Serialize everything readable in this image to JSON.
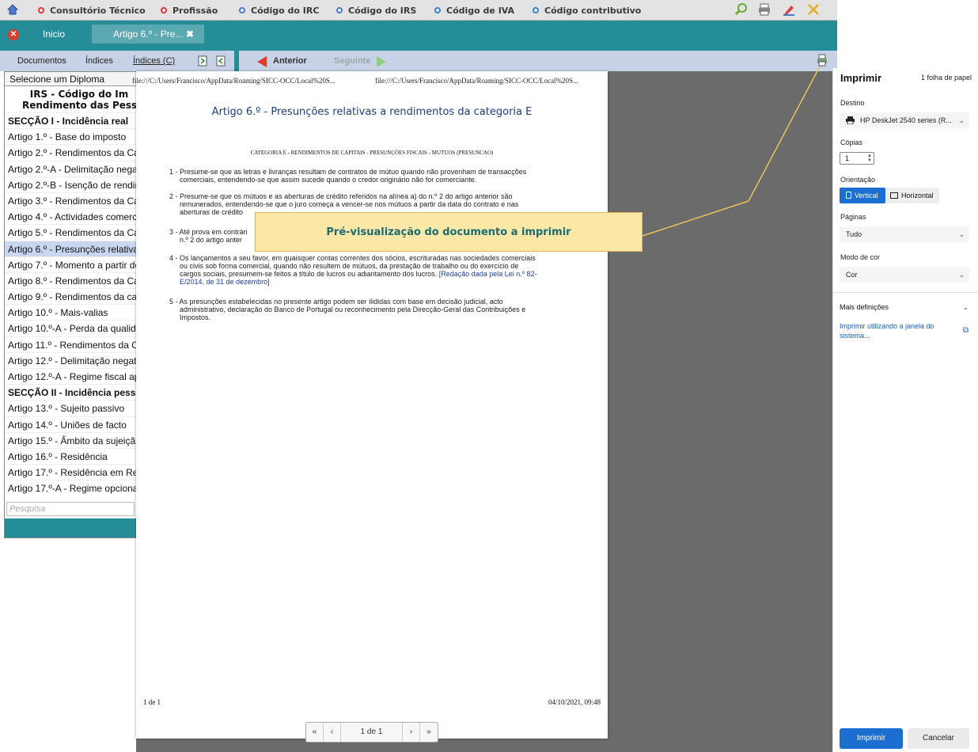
{
  "topbar": {
    "nav": [
      "Consultório Técnico",
      "Profissão",
      "Código do IRC",
      "Código do IRS",
      "Código de IVA",
      "Código contributivo"
    ],
    "nav_colors": [
      "red",
      "red",
      "blue",
      "blue",
      "blue",
      "blue"
    ]
  },
  "tabs": {
    "home": "Inicio",
    "current": "Artigo 6.º - Pre...",
    "close": "✖"
  },
  "subbar": {
    "documentos": "Documentos",
    "indices": "Índices",
    "indices_c": "Índices (C)",
    "anterior": "Anterior",
    "seguinte": "Seguinte"
  },
  "sidebar": {
    "select": "Selecione um Diploma",
    "diploma_line1": "IRS - Código do Im",
    "diploma_line2": "Rendimento das Pess",
    "items": [
      {
        "label": "SECÇÃO I - Incidência real",
        "type": "sec"
      },
      {
        "label": "Artigo 1.º - Base do imposto"
      },
      {
        "label": "Artigo 2.º - Rendimentos da Ca"
      },
      {
        "label": "Artigo 2.º-A - Delimitação negat"
      },
      {
        "label": "Artigo 2.º-B - Isenção de rendin"
      },
      {
        "label": "Artigo 3.º - Rendimentos da Ca"
      },
      {
        "label": "Artigo 4.º - Actividades comerci"
      },
      {
        "label": "Artigo 5.º - Rendimentos da Ca"
      },
      {
        "label": "Artigo 6.º - Presunções relativa",
        "type": "hl"
      },
      {
        "label": "Artigo 7.º - Momento a partir do"
      },
      {
        "label": "Artigo 8.º - Rendimentos da Ca"
      },
      {
        "label": "Artigo 9.º - Rendimentos da cat"
      },
      {
        "label": "Artigo 10.º - Mais-valias"
      },
      {
        "label": "Artigo 10.º-A - Perda da qualida"
      },
      {
        "label": "Artigo 11.º - Rendimentos da C"
      },
      {
        "label": "Artigo 12.º - Delimitação negati"
      },
      {
        "label": "Artigo 12.º-A - Regime fiscal ap"
      },
      {
        "label": "SECÇÃO II - Incidência pessoa",
        "type": "sec"
      },
      {
        "label": "Artigo 13.º - Sujeito passivo"
      },
      {
        "label": "Artigo 14.º - Uniões de facto"
      },
      {
        "label": "Artigo 15.º - Âmbito da sujeiçã"
      },
      {
        "label": "Artigo 16.º - Residência"
      },
      {
        "label": "Artigo 17.º - Residência em Re"
      },
      {
        "label": "Artigo 17.º-A - Regime opciona"
      }
    ],
    "search_placeholder": "Pesquisa"
  },
  "document": {
    "header_left": "file:///C:/Users/Francisco/AppData/Roaming/SICC-OCC/Local%20S...",
    "header_right": "file:///C:/Users/Francisco/AppData/Roaming/SICC-OCC/Local%20S...",
    "title": "Artigo 6.º - Presunções relativas a rendimentos da categoria E",
    "category": "CATEGORIA E - RENDIMENTOS DE CAPITAIS - PRESUNÇÕES FISCAIS - MUTUOS (PRESUNCAO)",
    "p1_a": "1 - Presume-se que as letras e livranças resultam de contratos de mútuo quando não provenham de transacções",
    "p1_b": "comerciais, entendendo-se que assim sucede quando o credor originário não for comerciante.",
    "p2_a": "2 - Presume-se que os mútuos e as aberturas de crédito referidos na alínea a) do n.º 2 do artigo anterior são",
    "p2_b": "remunerados, entendendo-se que o juro começa a vencer-se nos mútuos a partir da data do contrato e nas",
    "p2_c": "aberturas de crédito",
    "p3_a": "3 - Até prova em contrári",
    "p3_b": "n.º 2 do artigo anter",
    "p4_a": "4 - Os lançamentos a seu favor, em quaisquer contas correntes dos sócios, escrituradas nas sociedades comerciais",
    "p4_b": "ou civis sob forma comercial, quando não resultem de mútuos, da prestação de trabalho ou do exercício de",
    "p4_c": "cargos sociais, presumem-se feitos a título de lucros ou adiantamento dos lucros.",
    "p4_link_a": "[Redação dada pela Lei n.º 82-",
    "p4_link_b": "E/2014, de 31 de dezembro]",
    "p5_a": "5 - As presunções estabelecidas no presente artigo podem ser ilididas com base em decisão judicial, acto",
    "p5_b": "administrativo, declaração do Banco de Portugal ou reconhecimento pela Direcção-Geral das Contribuições e",
    "p5_c": "Impostos.",
    "footer_left": "1 de 1",
    "footer_right": "04/10/2021, 09:48"
  },
  "pager": {
    "first": "«",
    "prev": "‹",
    "current": "1 de 1",
    "next": "›",
    "last": "»"
  },
  "callout": "Pré-visualização do documento a imprimir",
  "print_panel": {
    "title": "Imprimir",
    "sheets": "1 folha de papel",
    "destino_label": "Destino",
    "destino": "HP DeskJet 2540 series (R...",
    "copias_label": "Cópias",
    "copias": "1",
    "orientacao_label": "Orientação",
    "vertical": "Vertical",
    "horizontal": "Horizontal",
    "paginas_label": "Páginas",
    "paginas": "Tudo",
    "cor_label": "Modo de cor",
    "cor": "Cor",
    "mais": "Mais definições",
    "sistema": "Imprimir utilizando a janela do sistema...",
    "imprimir": "Imprimir",
    "cancelar": "Cancelar"
  },
  "colors": {
    "teal": "#248d97",
    "accent_blue": "#1a6fd0",
    "callout_bg": "#fbe7a6",
    "highlight": "#c8d7ef"
  }
}
